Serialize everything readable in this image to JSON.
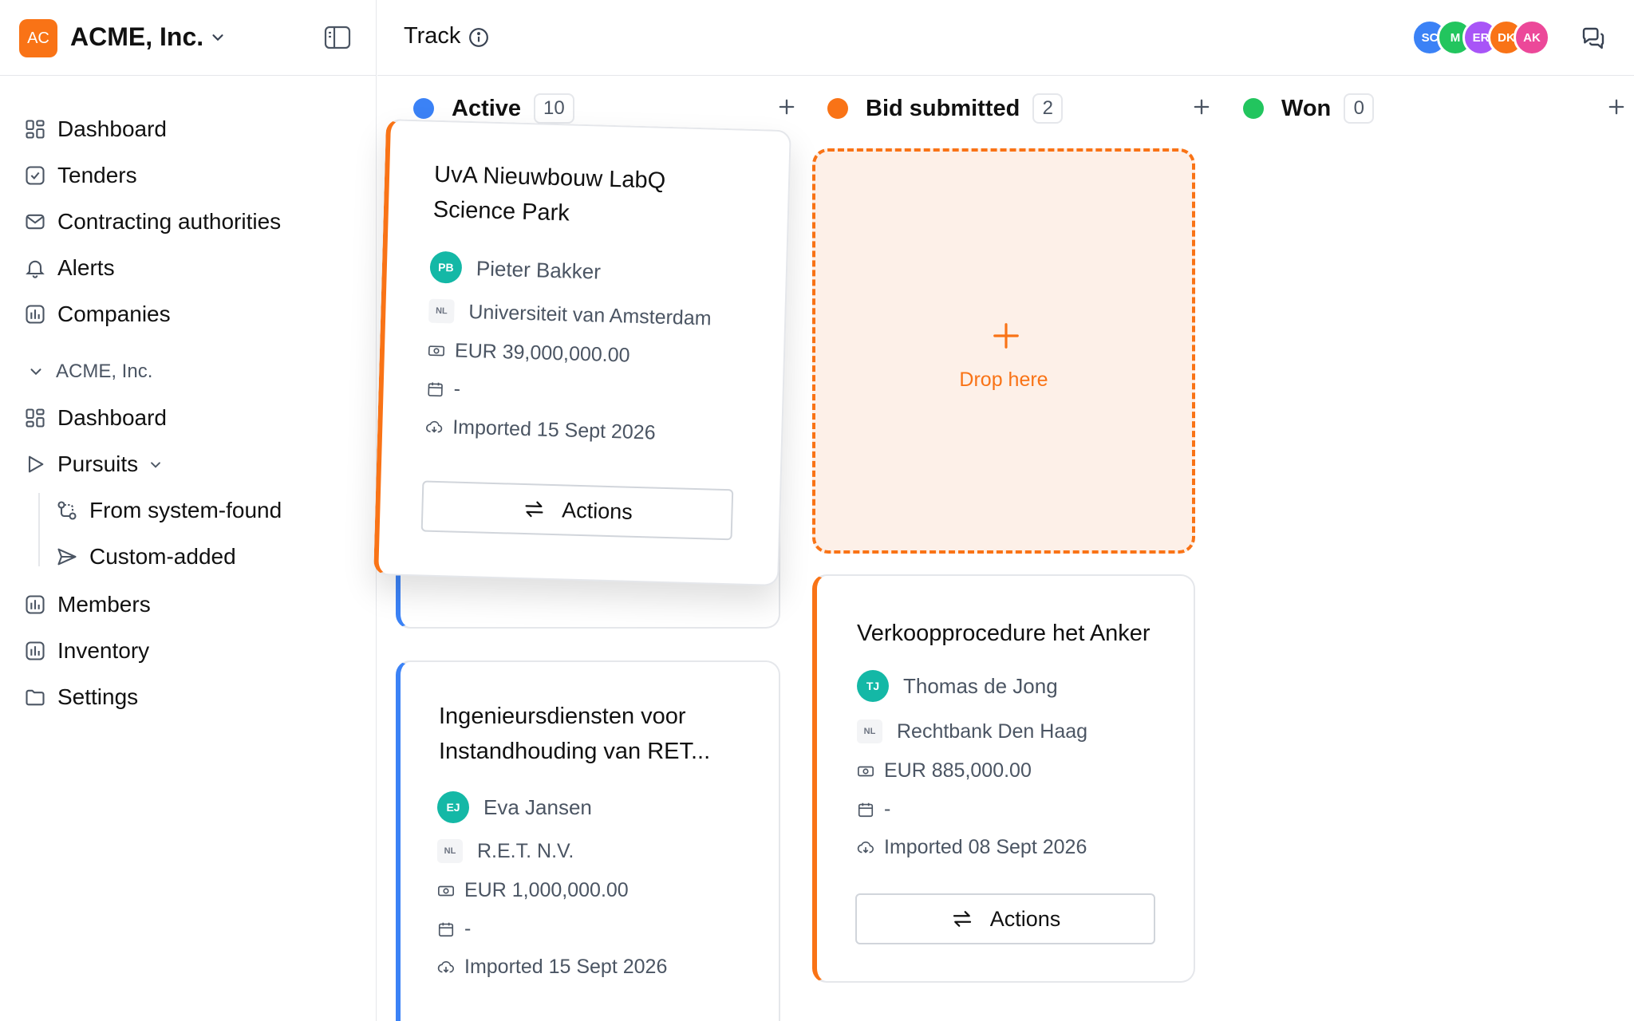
{
  "org": {
    "initials": "AC",
    "name": "ACME, Inc."
  },
  "nav": {
    "items": [
      {
        "label": "Dashboard"
      },
      {
        "label": "Tenders"
      },
      {
        "label": "Contracting authorities"
      },
      {
        "label": "Alerts"
      },
      {
        "label": "Companies"
      }
    ],
    "group_label": "ACME, Inc.",
    "group_items": [
      {
        "label": "Dashboard"
      },
      {
        "label": "Pursuits"
      },
      {
        "label": "From system-found"
      },
      {
        "label": "Custom-added"
      },
      {
        "label": "Members"
      },
      {
        "label": "Inventory"
      },
      {
        "label": "Settings"
      }
    ]
  },
  "header": {
    "title": "Track",
    "avatars": [
      {
        "initials": "SC",
        "color": "#3b82f6"
      },
      {
        "initials": "M",
        "color": "#22c55e"
      },
      {
        "initials": "ER",
        "color": "#a855f7"
      },
      {
        "initials": "DK",
        "color": "#f97316"
      },
      {
        "initials": "AK",
        "color": "#ec4899"
      }
    ]
  },
  "columns": [
    {
      "name": "Active",
      "count": "10",
      "color": "#3b82f6"
    },
    {
      "name": "Bid submitted",
      "count": "2",
      "color": "#f97316"
    },
    {
      "name": "Won",
      "count": "0",
      "color": "#22c55e"
    }
  ],
  "drop_zone": {
    "label": "Drop here"
  },
  "cards": {
    "dragged": {
      "title_line1": "UvA Nieuwbouw LabQ",
      "title_line2": "Science Park",
      "owner_initials": "PB",
      "owner": "Pieter Bakker",
      "country": "NL",
      "authority": "Universiteit van Amsterdam",
      "value": "EUR 39,000,000.00",
      "deadline": "-",
      "imported": "Imported 15 Sept 2026",
      "actions_label": "Actions"
    },
    "active_2": {
      "title_line1": "Ingenieursdiensten voor",
      "title_line2": "Instandhouding van RET...",
      "owner_initials": "EJ",
      "owner": "Eva Jansen",
      "country": "NL",
      "authority": "R.E.T. N.V.",
      "value": "EUR 1,000,000.00",
      "deadline": "-",
      "imported": "Imported 15 Sept 2026"
    },
    "bid_1": {
      "title_line1": "Verkoopprocedure het Anker",
      "owner_initials": "TJ",
      "owner": "Thomas de Jong",
      "country": "NL",
      "authority": "Rechtbank Den Haag",
      "value": "EUR 885,000.00",
      "deadline": "-",
      "imported": "Imported 08 Sept 2026",
      "actions_label": "Actions"
    }
  }
}
